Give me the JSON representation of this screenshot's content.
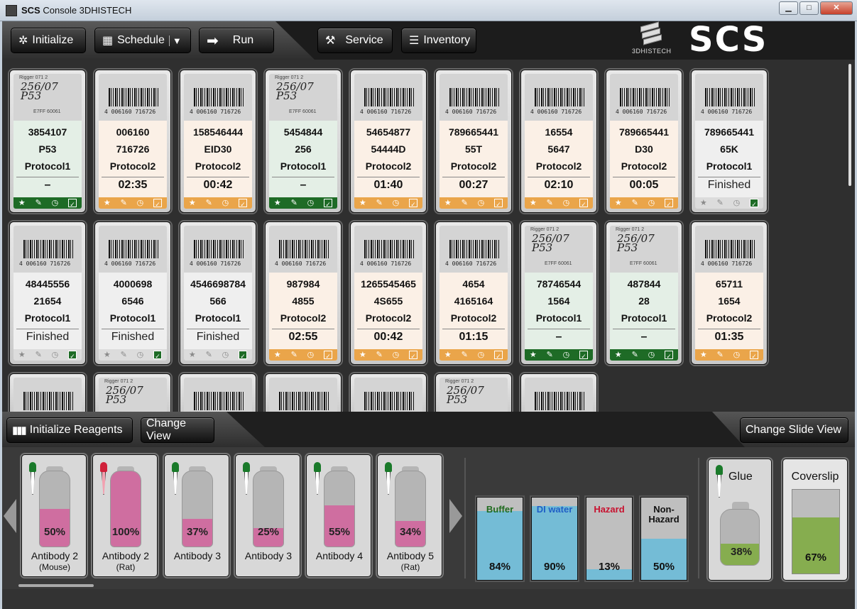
{
  "window": {
    "title_bold": "SCS",
    "title_rest": "Console 3DHISTECH",
    "minimize": "▁",
    "maximize": "□",
    "close": "✕"
  },
  "toolbar": {
    "initialize": "Initialize",
    "schedule": "Schedule",
    "schedule_dropdown": "▼",
    "run": "Run",
    "service": "Service",
    "inventory": "Inventory"
  },
  "logo": {
    "brand": "3DHISTECH",
    "product": "SCS"
  },
  "slides": [
    {
      "l1": "3854107",
      "l2": "P53",
      "l3": "Protocol1",
      "l4": "–",
      "state": "green",
      "label": "handwritten"
    },
    {
      "l1": "006160",
      "l2": "716726",
      "l3": "Protocol2",
      "l4": "02:35",
      "state": "orange",
      "label": "barcode"
    },
    {
      "l1": "158546444",
      "l2": "EID30",
      "l3": "Protocol2",
      "l4": "00:42",
      "state": "orange",
      "label": "barcode"
    },
    {
      "l1": "5454844",
      "l2": "256",
      "l3": "Protocol1",
      "l4": "–",
      "state": "green",
      "label": "handwritten"
    },
    {
      "l1": "54654877",
      "l2": "54444D",
      "l3": "Protocol2",
      "l4": "01:40",
      "state": "orange",
      "label": "barcode"
    },
    {
      "l1": "789665441",
      "l2": "55T",
      "l3": "Protocol2",
      "l4": "00:27",
      "state": "orange",
      "label": "barcode"
    },
    {
      "l1": "16554",
      "l2": "5647",
      "l3": "Protocol2",
      "l4": "02:10",
      "state": "orange",
      "label": "barcode"
    },
    {
      "l1": "789665441",
      "l2": "D30",
      "l3": "Protocol2",
      "l4": "00:05",
      "state": "orange",
      "label": "barcode"
    },
    {
      "l1": "789665441",
      "l2": "65K",
      "l3": "Protocol1",
      "l4": "Finished",
      "state": "grey",
      "label": "barcode"
    },
    {
      "l1": "48445556",
      "l2": "21654",
      "l3": "Protocol1",
      "l4": "Finished",
      "state": "grey",
      "label": "barcode"
    },
    {
      "l1": "4000698",
      "l2": "6546",
      "l3": "Protocol1",
      "l4": "Finished",
      "state": "grey",
      "label": "barcode"
    },
    {
      "l1": "4546698784",
      "l2": "566",
      "l3": "Protocol1",
      "l4": "Finished",
      "state": "grey",
      "label": "barcode"
    },
    {
      "l1": "987984",
      "l2": "4855",
      "l3": "Protocol2",
      "l4": "02:55",
      "state": "orange",
      "label": "barcode"
    },
    {
      "l1": "1265545465",
      "l2": "4S655",
      "l3": "Protocol2",
      "l4": "00:42",
      "state": "orange",
      "label": "barcode"
    },
    {
      "l1": "4654",
      "l2": "4165164",
      "l3": "Protocol2",
      "l4": "01:15",
      "state": "orange",
      "label": "barcode"
    },
    {
      "l1": "78746544",
      "l2": "1564",
      "l3": "Protocol1",
      "l4": "–",
      "state": "green",
      "label": "handwritten"
    },
    {
      "l1": "487844",
      "l2": "28",
      "l3": "Protocol1",
      "l4": "–",
      "state": "green",
      "label": "handwritten"
    },
    {
      "l1": "65711",
      "l2": "1654",
      "l3": "Protocol2",
      "l4": "01:35",
      "state": "orange",
      "label": "barcode"
    }
  ],
  "partial_slides": [
    "barcode",
    "handwritten",
    "barcode",
    "barcode",
    "barcode",
    "handwritten",
    "barcode"
  ],
  "barcode_text": "4 006160 716726",
  "handwritten_text": {
    "top": "Rigger 071 2",
    "line1": "256/07",
    "line2": "P53",
    "bottom": "E7FF 60061"
  },
  "footer_icons": [
    "★",
    "✎",
    "◷",
    "✓"
  ],
  "bottom_bar": {
    "init_reagents": "Initialize Reagents",
    "change_view": "Change View",
    "change_slide_view": "Change Slide View"
  },
  "reagents": [
    {
      "name": "Antibody 2",
      "sub": "(Mouse)",
      "pct": "50%",
      "fill": 0.5,
      "dropper": "#1a7a2a"
    },
    {
      "name": "Antibody 2",
      "sub": "(Rat)",
      "pct": "100%",
      "fill": 1.0,
      "dropper": "#d0213a"
    },
    {
      "name": "Antibody 3",
      "sub": "",
      "pct": "37%",
      "fill": 0.37,
      "dropper": "#1a7a2a"
    },
    {
      "name": "Antibody 3",
      "sub": "",
      "pct": "25%",
      "fill": 0.25,
      "dropper": "#1a7a2a"
    },
    {
      "name": "Antibody 4",
      "sub": "",
      "pct": "55%",
      "fill": 0.55,
      "dropper": "#1a7a2a"
    },
    {
      "name": "Antibody 5",
      "sub": "(Rat)",
      "pct": "34%",
      "fill": 0.34,
      "dropper": "#1a7a2a"
    }
  ],
  "tanks": [
    {
      "name": "Buffer",
      "pct": "84%",
      "fill": 0.84,
      "color": "#1f6b1f"
    },
    {
      "name": "DI water",
      "pct": "90%",
      "fill": 0.9,
      "color": "#1f5fc6"
    },
    {
      "name": "Hazard",
      "pct": "13%",
      "fill": 0.13,
      "color": "#c8102e"
    },
    {
      "name": "Non-Hazard",
      "pct": "50%",
      "fill": 0.5,
      "color": "#111111"
    }
  ],
  "glue": {
    "name": "Glue",
    "pct": "38%",
    "fill": 0.38
  },
  "coverslip": {
    "name": "Coverslip",
    "pct": "67%",
    "fill": 0.67
  },
  "colors": {
    "green": "#1e6b26",
    "orange": "#eaa54a",
    "pink": "#cf6ea0",
    "tank_blue": "#74bcd6",
    "glue_green": "#86ad4f"
  }
}
